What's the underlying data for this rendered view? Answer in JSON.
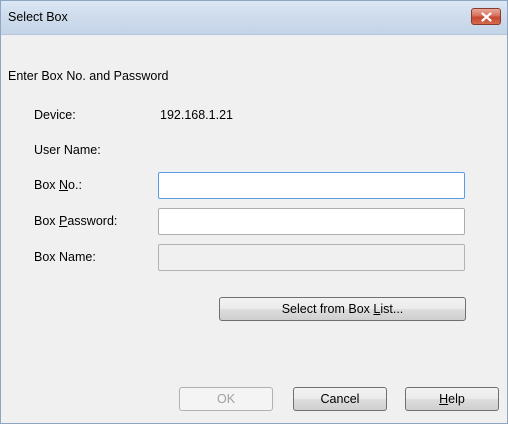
{
  "window": {
    "title": "Select Box"
  },
  "dialog": {
    "instruction": "Enter Box No. and Password",
    "device_label": "Device:",
    "device_value": "192.168.1.21",
    "user_name_label": "User Name:",
    "user_name_value": "",
    "box_no_label_pre": "Box ",
    "box_no_label_key": "N",
    "box_no_label_post": "o.:",
    "box_no_value": "",
    "box_password_label_pre": "Box ",
    "box_password_label_key": "P",
    "box_password_label_post": "assword:",
    "box_password_value": "",
    "box_name_label": "Box Name:",
    "box_name_value": "",
    "select_list_pre": "Select from Box ",
    "select_list_key": "L",
    "select_list_post": "ist...",
    "ok_label": "OK",
    "cancel_label": "Cancel",
    "help_key": "H",
    "help_post": "elp"
  },
  "icons": {
    "close": "close-icon"
  },
  "colors": {
    "titlebar": "#cfdcec",
    "close_button": "#c5482f",
    "focus_border": "#569de5",
    "dialog_background": "#f0f0f0"
  }
}
